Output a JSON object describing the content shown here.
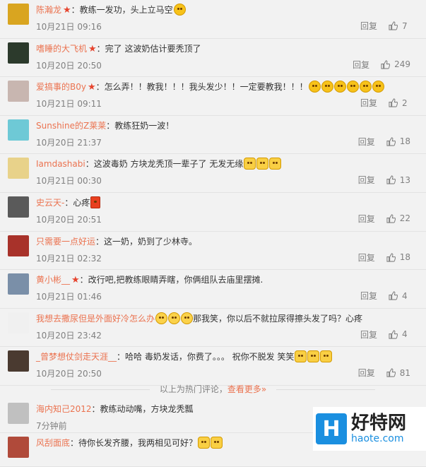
{
  "comments": [
    {
      "name": "陈瀚龙",
      "vip": true,
      "text": "：教练一发功，头上立马空",
      "emojis": [
        "smile"
      ],
      "time": "10月21日 09:16",
      "reply": "回复",
      "likes": "7",
      "avatar_color": "#d9a520"
    },
    {
      "name": "嗜睡的大飞机",
      "vip": true,
      "text": "：完了 这波奶估计要秃顶了",
      "emojis": [],
      "time": "10月20日 20:50",
      "reply": "回复",
      "likes": "249",
      "avatar_color": "#2c3a2c"
    },
    {
      "name": "爱搞事的B0y",
      "vip": true,
      "text": "：怎么弄！！教我！！！我头发少！！一定要教我！！！",
      "emojis": [
        "angry",
        "angry",
        "angry",
        "angry",
        "angry",
        "angry"
      ],
      "time": "10月21日 09:11",
      "reply": "回复",
      "likes": "2",
      "avatar_color": "#c8b6b0"
    },
    {
      "name": "Sunshine的Z莱莱",
      "vip": false,
      "text": "：教练狂奶一波！",
      "emojis": [],
      "time": "10月20日 21:37",
      "reply": "回复",
      "likes": "18",
      "avatar_color": "#6ec9d6"
    },
    {
      "name": "Iamdashabi",
      "vip": false,
      "text": "：这波毒奶 方块龙秃顶一辈子了 无发无缘",
      "emojis": [
        "cat",
        "cat",
        "cat"
      ],
      "time": "10月21日 00:30",
      "reply": "回复",
      "likes": "13",
      "avatar_color": "#e8d28a"
    },
    {
      "name": "史云天-",
      "vip": false,
      "text": "：心疼",
      "emojis": [
        "candle"
      ],
      "time": "10月20日 20:51",
      "reply": "回复",
      "likes": "22",
      "avatar_color": "#5a5a5a"
    },
    {
      "name": "只需要一点好运",
      "vip": false,
      "text": "：这一奶，奶到了少林寺。",
      "emojis": [],
      "time": "10月21日 02:32",
      "reply": "回复",
      "likes": "18",
      "avatar_color": "#a8322a"
    },
    {
      "name": "黄小彬__",
      "vip": true,
      "text": "：改行吧,把教练眼睛弄瞎，你俩组队去庙里摆摊.",
      "emojis": [],
      "time": "10月21日 01:46",
      "reply": "回复",
      "likes": "4",
      "avatar_color": "#7a8fa8"
    },
    {
      "name": "我想去撒尿但是外面好冷怎么办",
      "vip": false,
      "text": "那我笑，你以后不就拉尿得擦头发了吗？心疼",
      "pre_emojis": [
        "cry",
        "cry",
        "cry"
      ],
      "emojis": [],
      "time": "10月20日 23:42",
      "reply": "回复",
      "likes": "4",
      "avatar_color": "#f0f0f0"
    },
    {
      "name": "_曾梦想仗剑走天涯__",
      "vip": false,
      "text": "：哈哈 毒奶发话，你费了。。。 祝你不脱发 笑笑",
      "emojis": [
        "cat",
        "cat",
        "cat"
      ],
      "time": "10月20日 20:50",
      "reply": "回复",
      "likes": "81",
      "avatar_color": "#4a3a30"
    }
  ],
  "hot_footer": {
    "text": "以上为热门评论，",
    "link": "查看更多»"
  },
  "recent": [
    {
      "name": "海内知己2012",
      "text": "：教练动动嘴，方块龙秃瓢",
      "time": "7分钟前",
      "avatar_color": "#c0c0c0"
    },
    {
      "name": "风刮面底",
      "text": "：待你长发齐腰，我两相见可好？",
      "emojis": [
        "cat",
        "cat"
      ],
      "avatar_color": "#b04a3a"
    }
  ],
  "watermark": {
    "cn": "好特网",
    "en": "haote.com",
    "logo": "H"
  }
}
